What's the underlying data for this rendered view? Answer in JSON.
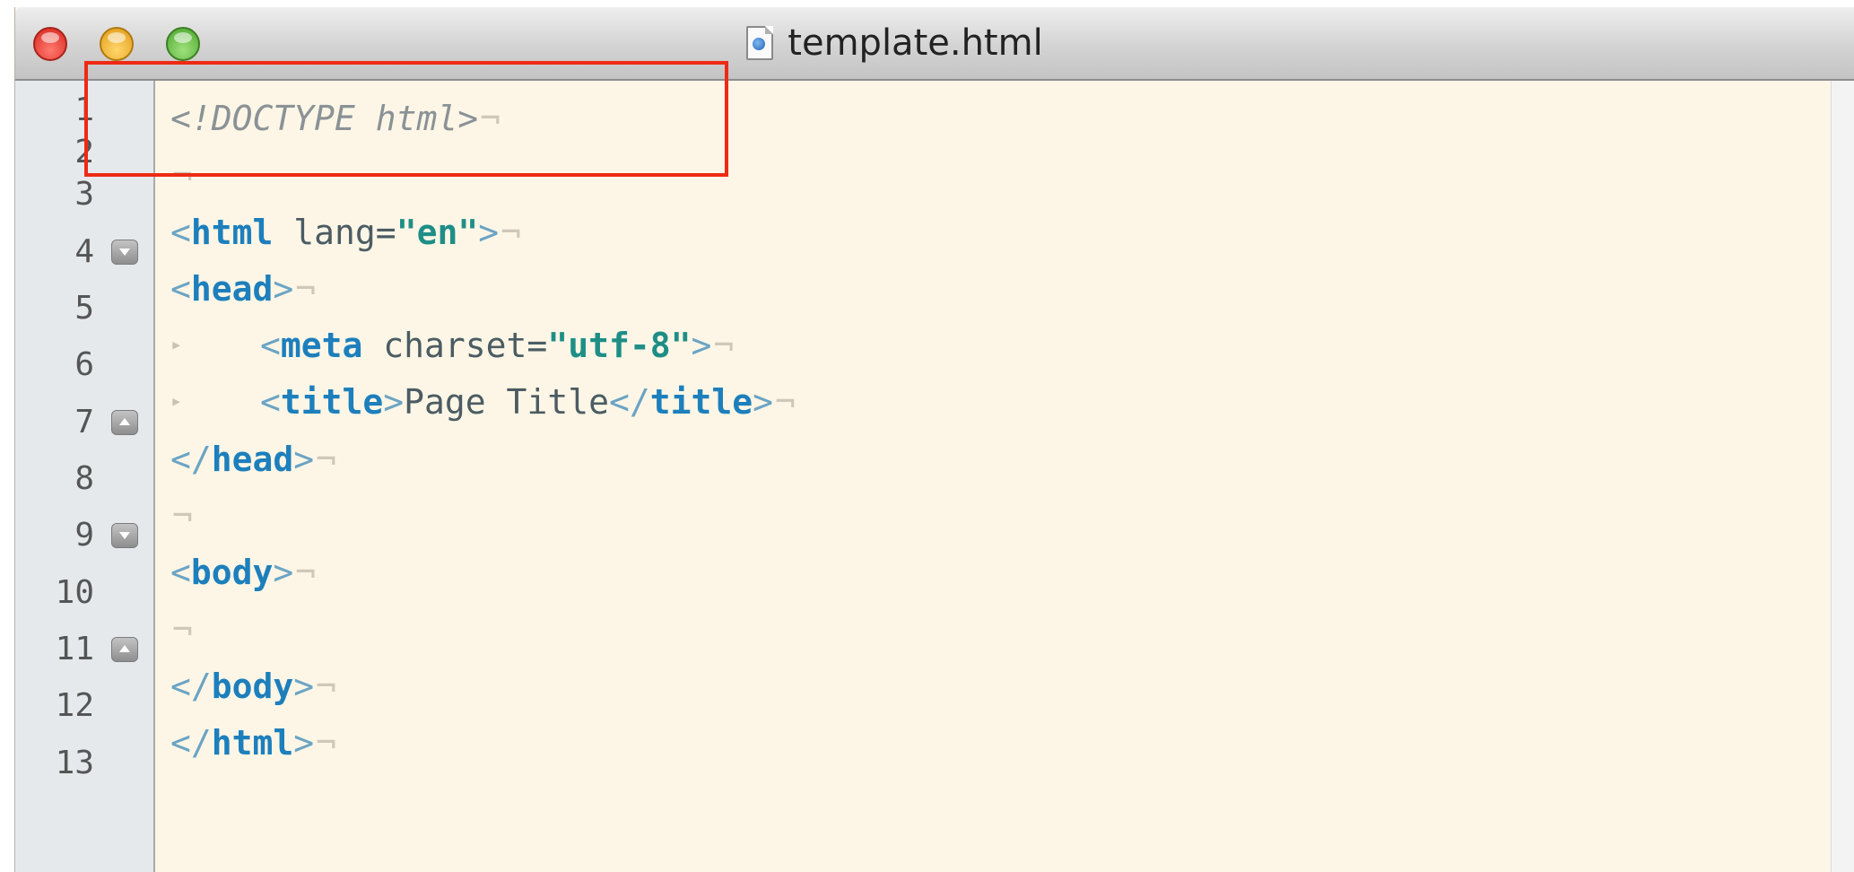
{
  "window": {
    "title": "template.html",
    "file_icon": "html-file-icon"
  },
  "colors": {
    "tag": "#1d7fbc",
    "string": "#1e8e86",
    "doctype": "#8a9296",
    "editor_bg": "#fdf6e6",
    "highlight": "#ee2a14"
  },
  "gutter": {
    "line_numbers": [
      "1",
      "2",
      "3",
      "4",
      "5",
      "6",
      "7",
      "8",
      "9",
      "10",
      "11",
      "12",
      "13"
    ]
  },
  "code": {
    "l1_doctype": "<!DOCTYPE html>",
    "l3_open": "<",
    "l3_tag": "html",
    "l3_attr": " lang=",
    "l3_val": "\"en\"",
    "l3_close": ">",
    "l4_open": "<",
    "l4_tag": "head",
    "l4_close": ">",
    "l5_open": "<",
    "l5_tag": "meta",
    "l5_attr": " charset=",
    "l5_val": "\"utf-8\"",
    "l5_close": ">",
    "l6_open": "<",
    "l6_tag": "title",
    "l6_close1": ">",
    "l6_text": "Page Title",
    "l6_open2": "</",
    "l6_tag2": "title",
    "l6_close2": ">",
    "l7_open": "</",
    "l7_tag": "head",
    "l7_close": ">",
    "l9_open": "<",
    "l9_tag": "body",
    "l9_close": ">",
    "l11_open": "</",
    "l11_tag": "body",
    "l11_close": ">",
    "l12_open": "</",
    "l12_tag": "html",
    "l12_close": ">",
    "newline_mark": "¬",
    "tab_mark": "▸"
  }
}
